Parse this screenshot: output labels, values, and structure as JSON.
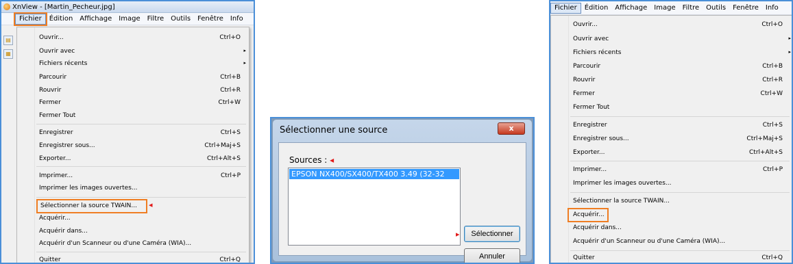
{
  "left": {
    "window_title": "XnView - [Martin_Pecheur.jpg]",
    "menubar": [
      "Fichier",
      "Édition",
      "Affichage",
      "Image",
      "Filtre",
      "Outils",
      "Fenêtre",
      "Info"
    ],
    "menu_items": [
      {
        "label": "Ouvrir...",
        "shortcut": "Ctrl+O"
      },
      {
        "label": "Ouvrir avec",
        "shortcut": "▸"
      },
      {
        "label": "Fichiers récents",
        "shortcut": "▸"
      },
      {
        "label": "Parcourir",
        "shortcut": "Ctrl+B"
      },
      {
        "label": "Rouvrir",
        "shortcut": "Ctrl+R"
      },
      {
        "label": "Fermer",
        "shortcut": "Ctrl+W"
      },
      {
        "label": "Fermer Tout",
        "shortcut": ""
      },
      {
        "label": "Enregistrer",
        "shortcut": "Ctrl+S"
      },
      {
        "label": "Enregistrer sous...",
        "shortcut": "Ctrl+Maj+S"
      },
      {
        "label": "Exporter...",
        "shortcut": "Ctrl+Alt+S"
      },
      {
        "label": "Imprimer...",
        "shortcut": "Ctrl+P"
      },
      {
        "label": "Imprimer les images ouvertes...",
        "shortcut": ""
      },
      {
        "label": "Sélectionner la source TWAIN...",
        "shortcut": ""
      },
      {
        "label": "Acquérir...",
        "shortcut": ""
      },
      {
        "label": "Acquérir dans...",
        "shortcut": ""
      },
      {
        "label": "Acquérir d'un Scanneur ou d'une Caméra (WIA)...",
        "shortcut": ""
      },
      {
        "label": "Quitter",
        "shortcut": "Ctrl+Q"
      }
    ]
  },
  "dialog": {
    "title": "Sélectionner une source",
    "close_label": "x",
    "sources_label": "Sources :",
    "list_items": [
      "EPSON NX400/SX400/TX400 3.49 (32-32"
    ],
    "select_button": "Sélectionner",
    "cancel_button": "Annuler"
  },
  "right": {
    "menubar": [
      "Fichier",
      "Édition",
      "Affichage",
      "Image",
      "Filtre",
      "Outils",
      "Fenêtre",
      "Info"
    ],
    "menu_items": [
      {
        "label": "Ouvrir...",
        "shortcut": "Ctrl+O"
      },
      {
        "label": "Ouvrir avec",
        "shortcut": "▸"
      },
      {
        "label": "Fichiers récents",
        "shortcut": "▸"
      },
      {
        "label": "Parcourir",
        "shortcut": "Ctrl+B"
      },
      {
        "label": "Rouvrir",
        "shortcut": "Ctrl+R"
      },
      {
        "label": "Fermer",
        "shortcut": "Ctrl+W"
      },
      {
        "label": "Fermer Tout",
        "shortcut": ""
      },
      {
        "label": "Enregistrer",
        "shortcut": "Ctrl+S"
      },
      {
        "label": "Enregistrer sous...",
        "shortcut": "Ctrl+Maj+S"
      },
      {
        "label": "Exporter...",
        "shortcut": "Ctrl+Alt+S"
      },
      {
        "label": "Imprimer...",
        "shortcut": "Ctrl+P"
      },
      {
        "label": "Imprimer les images ouvertes...",
        "shortcut": ""
      },
      {
        "label": "Sélectionner la source TWAIN...",
        "shortcut": ""
      },
      {
        "label": "Acquérir...",
        "shortcut": ""
      },
      {
        "label": "Acquérir dans...",
        "shortcut": ""
      },
      {
        "label": "Acquérir d'un Scanneur ou d'une Caméra (WIA)...",
        "shortcut": ""
      },
      {
        "label": "Quitter",
        "shortcut": "Ctrl+Q"
      }
    ]
  },
  "colors": {
    "highlight_box": "#ef7d22",
    "annotation_arrow": "#e21b1b",
    "panel_border": "#4a8fd8",
    "list_selection": "#3399ff"
  }
}
